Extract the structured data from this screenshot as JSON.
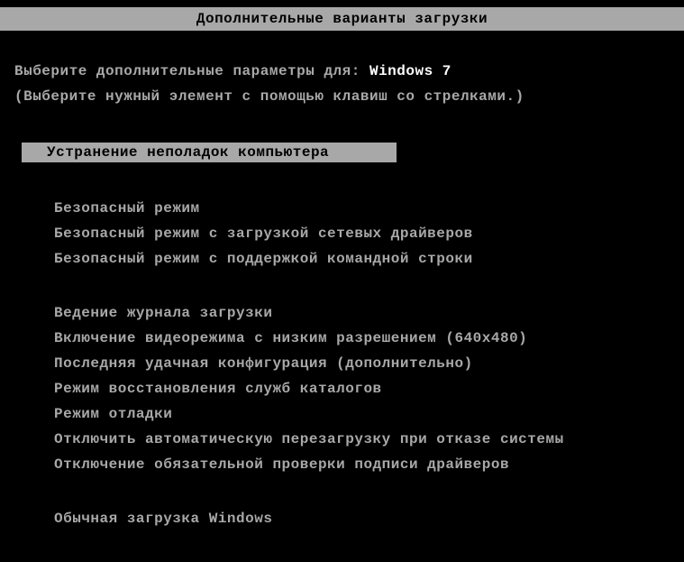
{
  "header": {
    "title": "Дополнительные варианты загрузки"
  },
  "prompt": {
    "prefix": "Выберите дополнительные параметры для: ",
    "os": "Windows 7",
    "instruction": "(Выберите нужный элемент с помощью клавиш со стрелками.)"
  },
  "menu": {
    "selected": "Устранение неполадок компьютера",
    "group1": [
      "Безопасный режим",
      "Безопасный режим с загрузкой сетевых драйверов",
      "Безопасный режим с поддержкой командной строки"
    ],
    "group2": [
      "Ведение журнала загрузки",
      "Включение видеорежима с низким разрешением (640x480)",
      "Последняя удачная конфигурация (дополнительно)",
      "Режим восстановления служб каталогов",
      "Режим отладки",
      "Отключить автоматическую перезагрузку при отказе системы",
      "Отключение обязательной проверки подписи драйверов"
    ],
    "group3": [
      "Обычная загрузка Windows"
    ]
  }
}
